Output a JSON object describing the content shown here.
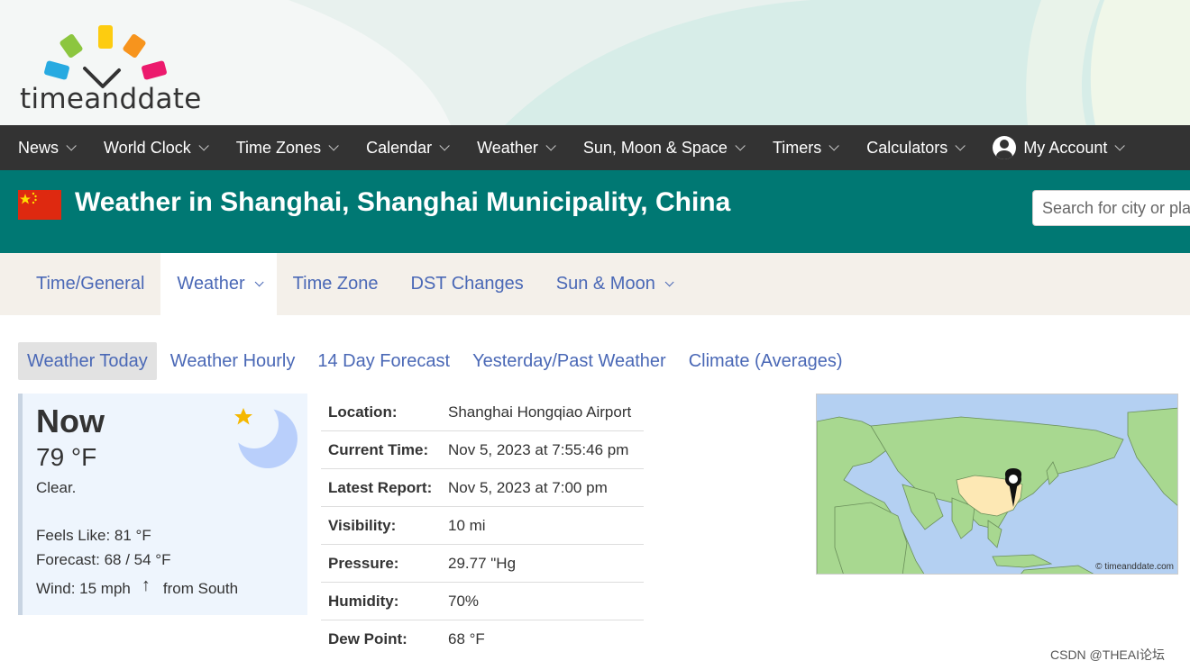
{
  "brand": {
    "name_part1": "time",
    "name_part2": "and",
    "name_part3": "date"
  },
  "main_nav": [
    {
      "label": "News"
    },
    {
      "label": "World Clock"
    },
    {
      "label": "Time Zones"
    },
    {
      "label": "Calendar"
    },
    {
      "label": "Weather"
    },
    {
      "label": "Sun, Moon & Space"
    },
    {
      "label": "Timers"
    },
    {
      "label": "Calculators"
    },
    {
      "label": "My Account"
    }
  ],
  "title_bar": {
    "title": "Weather in Shanghai, Shanghai Municipality, China",
    "search_placeholder": "Search for city or place..."
  },
  "sub_nav": [
    {
      "label": "Time/General"
    },
    {
      "label": "Weather"
    },
    {
      "label": "Time Zone"
    },
    {
      "label": "DST Changes"
    },
    {
      "label": "Sun & Moon"
    }
  ],
  "tabs": [
    {
      "label": "Weather Today"
    },
    {
      "label": "Weather Hourly"
    },
    {
      "label": "14 Day Forecast"
    },
    {
      "label": "Yesterday/Past Weather"
    },
    {
      "label": "Climate (Averages)"
    }
  ],
  "now": {
    "heading": "Now",
    "temperature": "79 °F",
    "condition": "Clear.",
    "feels_like": "Feels Like: 81 °F",
    "forecast": "Forecast: 68 / 54 °F",
    "wind_speed": "Wind: 15 mph",
    "wind_arrow": "↑",
    "wind_direction": "from South"
  },
  "details": [
    {
      "label": "Location:",
      "value": "Shanghai Hongqiao Airport"
    },
    {
      "label": "Current Time:",
      "value": "Nov 5, 2023 at 7:55:46 pm"
    },
    {
      "label": "Latest Report:",
      "value": "Nov 5, 2023 at 7:00 pm"
    },
    {
      "label": "Visibility:",
      "value": "10 mi"
    },
    {
      "label": "Pressure:",
      "value": "29.77 \"Hg"
    },
    {
      "label": "Humidity:",
      "value": "70%"
    },
    {
      "label": "Dew Point:",
      "value": "68 °F"
    }
  ],
  "map": {
    "credit": "© timeanddate.com"
  },
  "watermark": "CSDN @THEAI论坛",
  "colors": {
    "nav_bg": "#333333",
    "title_bg": "#007873",
    "link": "#4a68b6",
    "subnav_bg": "#f4f0ea",
    "card_bg": "#eef5fd"
  }
}
